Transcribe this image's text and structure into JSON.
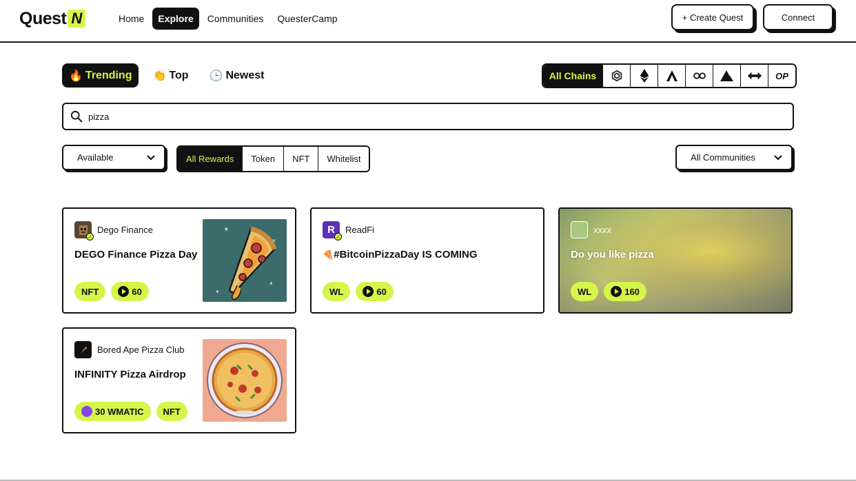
{
  "header": {
    "logo_text": "Quest",
    "logo_mark": "N",
    "nav": [
      "Home",
      "Explore",
      "Communities",
      "QuesterCamp"
    ],
    "active_nav": "Explore",
    "create_label": "+ Create Quest",
    "connect_label": "Connect"
  },
  "sort_tabs": [
    {
      "label": "Trending",
      "emoji": "🔥",
      "active": true
    },
    {
      "label": "Top",
      "emoji": "👏",
      "active": false
    },
    {
      "label": "Newest",
      "emoji": "🕒",
      "active": false
    }
  ],
  "chains": {
    "all_label": "All Chains",
    "icons": [
      "bnb-chain-icon",
      "ethereum-icon",
      "arbitrum-icon",
      "chainlink-icon",
      "avalanche-icon",
      "multichain-icon",
      "optimism-icon"
    ],
    "op_label": "OP"
  },
  "search": {
    "value": "pizza",
    "placeholder": "Search"
  },
  "filters": {
    "availability": "Available",
    "rewards": [
      "All Rewards",
      "Token",
      "NFT",
      "Whitelist"
    ],
    "active_reward": "All Rewards",
    "communities": "All Communities"
  },
  "cards": [
    {
      "community": "Dego Finance",
      "title": "DEGO Finance Pizza Day",
      "badges": [
        "NFT"
      ],
      "points": "60"
    },
    {
      "community": "ReadFi",
      "title": "#BitcoinPizzaDay IS COMING",
      "title_emoji": "🍕",
      "badges": [
        "WL"
      ],
      "points": "60"
    },
    {
      "community": "xxxx",
      "title": "Do you like pizza",
      "badges": [
        "WL"
      ],
      "points": "160"
    },
    {
      "community": "Bored Ape Pizza Club",
      "title": "INFINITY Pizza Airdrop",
      "token_badge": "30 WMATIC",
      "badges": [
        "NFT"
      ]
    }
  ],
  "colors": {
    "accent": "#d6f54a",
    "ink": "#111111",
    "matic": "#8247e5"
  }
}
